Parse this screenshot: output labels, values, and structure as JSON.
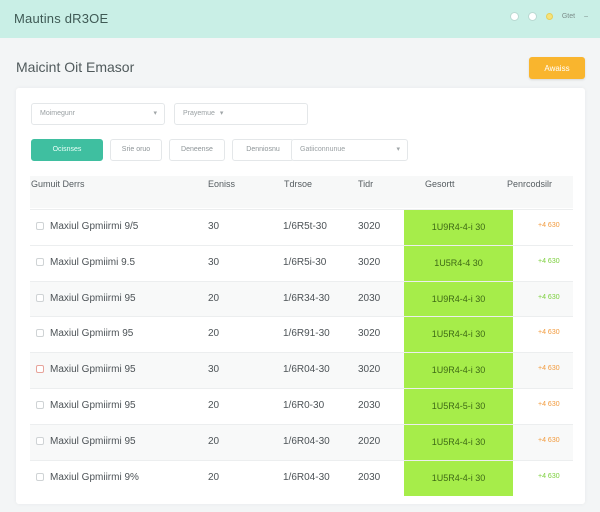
{
  "app": {
    "title": "Mautins dR3OE",
    "top_right_label": "Gtet"
  },
  "page": {
    "title": "Maicint Oit Emasor",
    "primary_action": "Awaiss"
  },
  "filters": {
    "select1": "Moimegunr",
    "select2": "Prayemue",
    "select_long": "Gatiiconnunue"
  },
  "chips": [
    "Ocisnses",
    "Srie oruo",
    "Deneense",
    "Denniosnu"
  ],
  "table": {
    "headers": [
      "Gumuit Derrs",
      "Eoniss",
      "Tdrsoe",
      "Tidr",
      "Gesortt",
      "Penrcodsilr"
    ],
    "rows": [
      {
        "name": "Maxiul Gpmiirmi 9/5",
        "qty": "30",
        "code": "1/6R5t-30",
        "year": "3020",
        "status": "1U9R4-4-i 30",
        "badge": "+4 630",
        "badge_color": "orange",
        "checkbox": "plain",
        "alt": false
      },
      {
        "name": "Maxiul Gpmiimi 9.5",
        "qty": "30",
        "code": "1/6R5i-30",
        "year": "3020",
        "status": "1U5R4-4 30",
        "badge": "+4 630",
        "badge_color": "green",
        "checkbox": "plain",
        "alt": false
      },
      {
        "name": "Maxiul Gpmiirmi 95",
        "qty": "20",
        "code": "1/6R34-30",
        "year": "2030",
        "status": "1U9R4-4-i 30",
        "badge": "+4 630",
        "badge_color": "green",
        "checkbox": "plain",
        "alt": true
      },
      {
        "name": "Maxiul Gpmiirm 95",
        "qty": "20",
        "code": "1/6R91-30",
        "year": "3020",
        "status": "1U5R4-4-i 30",
        "badge": "+4 630",
        "badge_color": "orange",
        "checkbox": "plain",
        "alt": false
      },
      {
        "name": "Maxiul Gpmiirmi 95",
        "qty": "30",
        "code": "1/6R04-30",
        "year": "3020",
        "status": "1U9R4-4-i 30",
        "badge": "+4 630",
        "badge_color": "orange",
        "checkbox": "red",
        "alt": true
      },
      {
        "name": "Maxiul Gpmiirmi 95",
        "qty": "20",
        "code": "1/6R0-30",
        "year": "2030",
        "status": "1U5R4-5-i 30",
        "badge": "+4 630",
        "badge_color": "orange",
        "checkbox": "plain",
        "alt": false
      },
      {
        "name": "Maxiul Gpmiirmi 95",
        "qty": "20",
        "code": "1/6R04-30",
        "year": "2020",
        "status": "1U5R4-4-i 30",
        "badge": "+4 630",
        "badge_color": "orange",
        "checkbox": "plain",
        "alt": true
      },
      {
        "name": "Maxiul Gpmiirmi 9%",
        "qty": "20",
        "code": "1/6R04-30",
        "year": "2030",
        "status": "1U5R4-4-i 30",
        "badge": "+4 630",
        "badge_color": "green",
        "checkbox": "plain",
        "alt": false
      }
    ]
  },
  "colors": {
    "topbar": "#c9efe6",
    "accent_teal": "#3fbfa0",
    "accent_orange": "#f9b52e",
    "status_green": "#a6ed4a"
  }
}
